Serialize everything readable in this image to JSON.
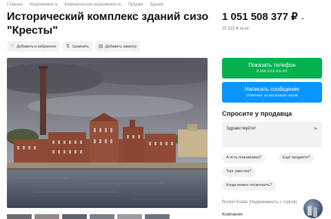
{
  "breadcrumb": [
    "Главная",
    "Недвижимость",
    "Коммерческая недвижимость",
    "Продам",
    "Здание"
  ],
  "breadcrumb_separator": "·",
  "listing": {
    "title": "Исторический комплекс зданий сизо \"Кресты\"",
    "price": "1 051 508 377 ₽",
    "price_per_unit": "25 522 ₽ за м²"
  },
  "actions": [
    {
      "icon": "heart-icon",
      "label": "Добавить в избранное"
    },
    {
      "icon": "compare-icon",
      "label": "Сравнить"
    },
    {
      "icon": "note-icon",
      "label": "Добавить заметку"
    }
  ],
  "contact": {
    "phone_label": "Показать телефон",
    "phone_masked": "8 958 XXX-XX-XX",
    "message_label": "Написать сообщение",
    "message_sub": "Отвечает за несколько часов"
  },
  "ask": {
    "title": "Спросите у продавца",
    "message_value": "Здравствуйте!",
    "quick_questions": [
      "А есть планировка?",
      "Ещё продаете?",
      "Торг уместен?",
      "Когда можно посмотреть?"
    ]
  },
  "seller": {
    "name": "Rocket Estate (Недвижимость с торгов)",
    "type": "Компания"
  },
  "colors": {
    "accent_green": "#05b24f",
    "accent_blue": "#0a95ff"
  },
  "icons": {
    "price_dropdown": "chevron-down-icon",
    "send": "send-icon"
  }
}
